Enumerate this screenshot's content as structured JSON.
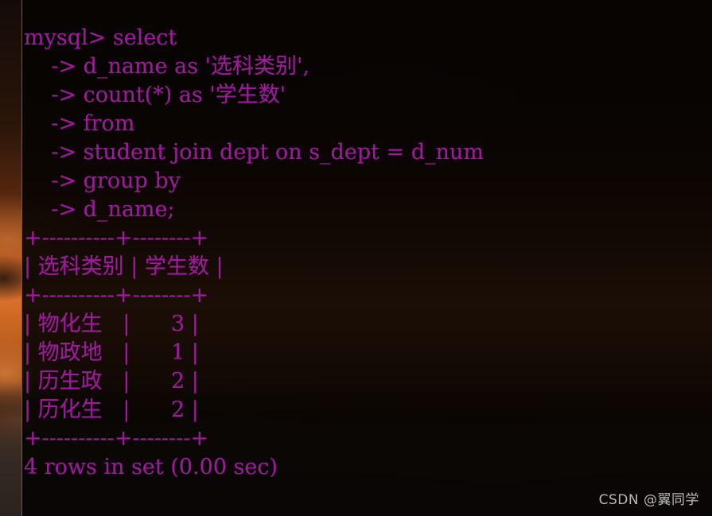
{
  "window": {
    "kind": "mysql-terminal",
    "text_color": "#9B1C9B",
    "background_color": "#050302"
  },
  "terminal": {
    "lines": [
      "mysql> select",
      "    -> d_name as '选科类别',",
      "    -> count(*) as '学生数'",
      "    -> from",
      "    -> student join dept on s_dept = d_num",
      "    -> group by",
      "    -> d_name;",
      "+----------+--------+",
      "| 选科类别 | 学生数 |",
      "+----------+--------+",
      "| 物化生   |      3 |",
      "| 物政地   |      1 |",
      "| 历生政   |      2 |",
      "| 历化生   |      2 |",
      "+----------+--------+",
      "4 rows in set (0.00 sec)"
    ],
    "prompt": "mysql>",
    "continuation_prompt": "->",
    "query": {
      "statement": "select d_name as '选科类别', count(*) as '学生数' from student join dept on s_dept = d_num group by d_name;",
      "select_columns": [
        "d_name as '选科类别'",
        "count(*) as '学生数'"
      ],
      "from_tables": "student join dept on s_dept = d_num",
      "group_by": "d_name"
    },
    "result_table": {
      "headers": [
        "选科类别",
        "学生数"
      ],
      "rows": [
        [
          "物化生",
          "3"
        ],
        [
          "物政地",
          "1"
        ],
        [
          "历生政",
          "2"
        ],
        [
          "历化生",
          "2"
        ]
      ],
      "border_top": "+----------+--------+",
      "border_mid": "+----------+--------+",
      "border_bottom": "+----------+--------+"
    },
    "status_line": "4 rows in set (0.00 sec)",
    "row_count": 4,
    "elapsed": "0.00 sec"
  },
  "watermark": {
    "text": "CSDN @翼同学"
  }
}
